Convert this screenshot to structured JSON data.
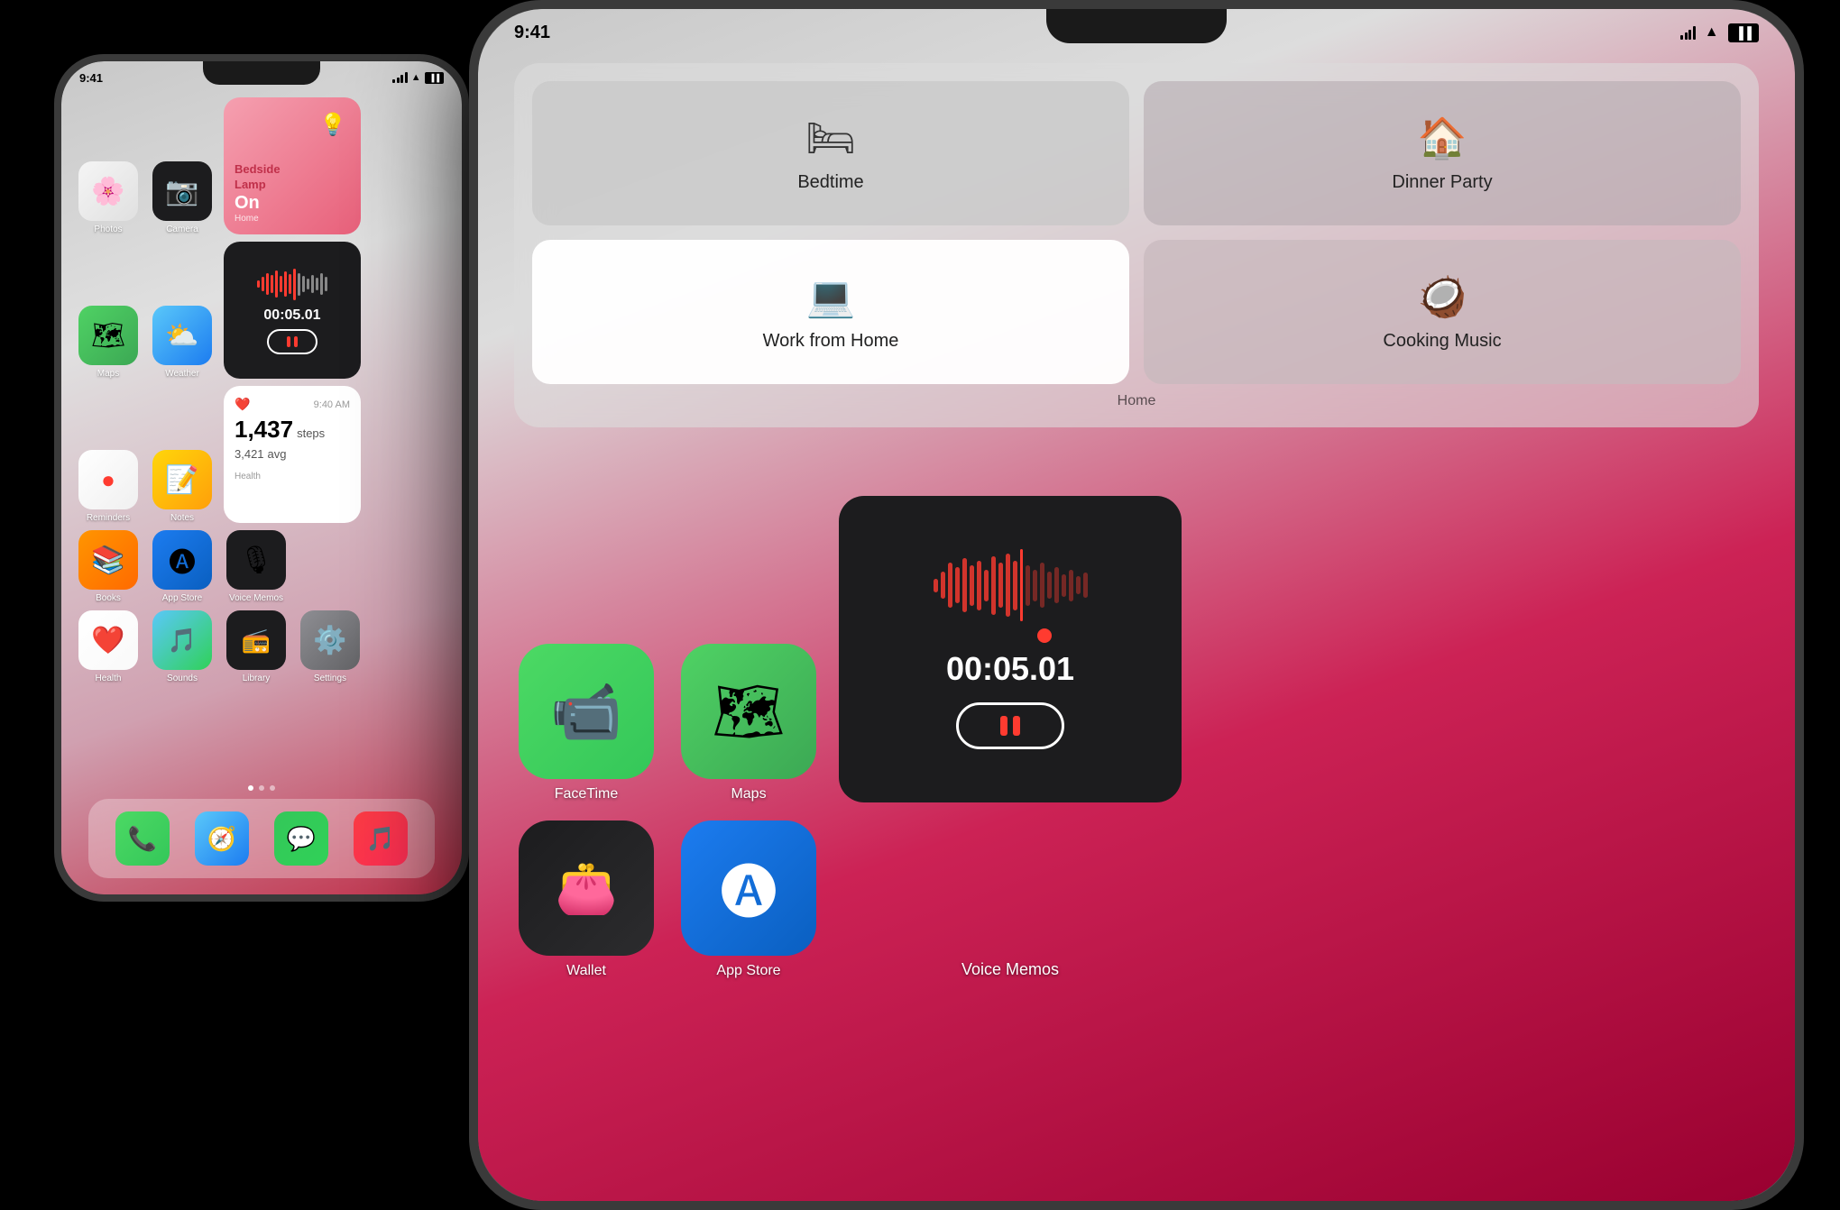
{
  "small_phone": {
    "status_time": "9:41",
    "apps_row1": [
      {
        "name": "Photos",
        "label": "Photos",
        "bg": "bg-photos"
      },
      {
        "name": "Camera",
        "label": "Camera",
        "bg": "bg-camera"
      },
      {
        "name": "widget_home",
        "label": ""
      }
    ],
    "apps_row2": [
      {
        "name": "Maps",
        "label": "Maps",
        "bg": "bg-maps"
      },
      {
        "name": "Weather",
        "label": "Weather",
        "bg": "bg-weather"
      },
      {
        "name": "widget_voice",
        "label": ""
      }
    ],
    "apps_row3": [
      {
        "name": "Reminders",
        "label": "Reminders",
        "bg": "bg-reminders"
      },
      {
        "name": "Notes",
        "label": "Notes",
        "bg": "bg-notes"
      },
      {
        "name": "widget_health",
        "label": ""
      }
    ],
    "apps_row4": [
      {
        "name": "Books",
        "label": "Books",
        "bg": "bg-books"
      },
      {
        "name": "App Store",
        "label": "App Store",
        "bg": "bg-appstore"
      }
    ],
    "apps_row5": [
      {
        "name": "Health",
        "label": "Health",
        "bg": "bg-health"
      },
      {
        "name": "Sounds",
        "label": "Sounds",
        "bg": "bg-sounds"
      },
      {
        "name": "Library",
        "label": "Library",
        "bg": "bg-library"
      },
      {
        "name": "Settings",
        "label": "Settings",
        "bg": "bg-settings"
      }
    ],
    "widget_home": {
      "title": "Bedside\nLamp",
      "status": "On",
      "footer": "Home"
    },
    "widget_voice": {
      "time": "00:05.01"
    },
    "widget_health": {
      "time": "9:40 AM",
      "steps": "1,437",
      "steps_label": "steps",
      "avg": "3,421",
      "avg_label": "avg",
      "footer": "Health"
    },
    "dock": [
      "Phone",
      "Safari",
      "Messages",
      "Music"
    ]
  },
  "large_phone": {
    "status_time": "9:41",
    "home_shortcuts": [
      {
        "id": "bedtime",
        "icon": "🛏",
        "label": "Bedtime"
      },
      {
        "id": "dinner",
        "icon": "🏠",
        "label": "Dinner Party"
      },
      {
        "id": "work",
        "icon": "💻",
        "label": "Work from Home"
      },
      {
        "id": "cooking",
        "icon": "🥥",
        "label": "Cooking Music"
      }
    ],
    "home_label": "Home",
    "apps_row1": [
      {
        "name": "FaceTime",
        "label": "FaceTime",
        "bg": "bg-facetime"
      },
      {
        "name": "Maps",
        "label": "Maps",
        "bg": "bg-maps"
      },
      {
        "name": "voice_widget",
        "label": ""
      }
    ],
    "apps_row2": [
      {
        "name": "Wallet",
        "label": "Wallet",
        "bg": "bg-wallet"
      },
      {
        "name": "App Store",
        "label": "App Store",
        "bg": "bg-appstore"
      },
      {
        "name": "Voice Memos",
        "label": "Voice Memos"
      }
    ],
    "voice_widget": {
      "time": "00:05.01"
    }
  },
  "colors": {
    "accent_red": "#ff3b30",
    "background": "#000000"
  }
}
